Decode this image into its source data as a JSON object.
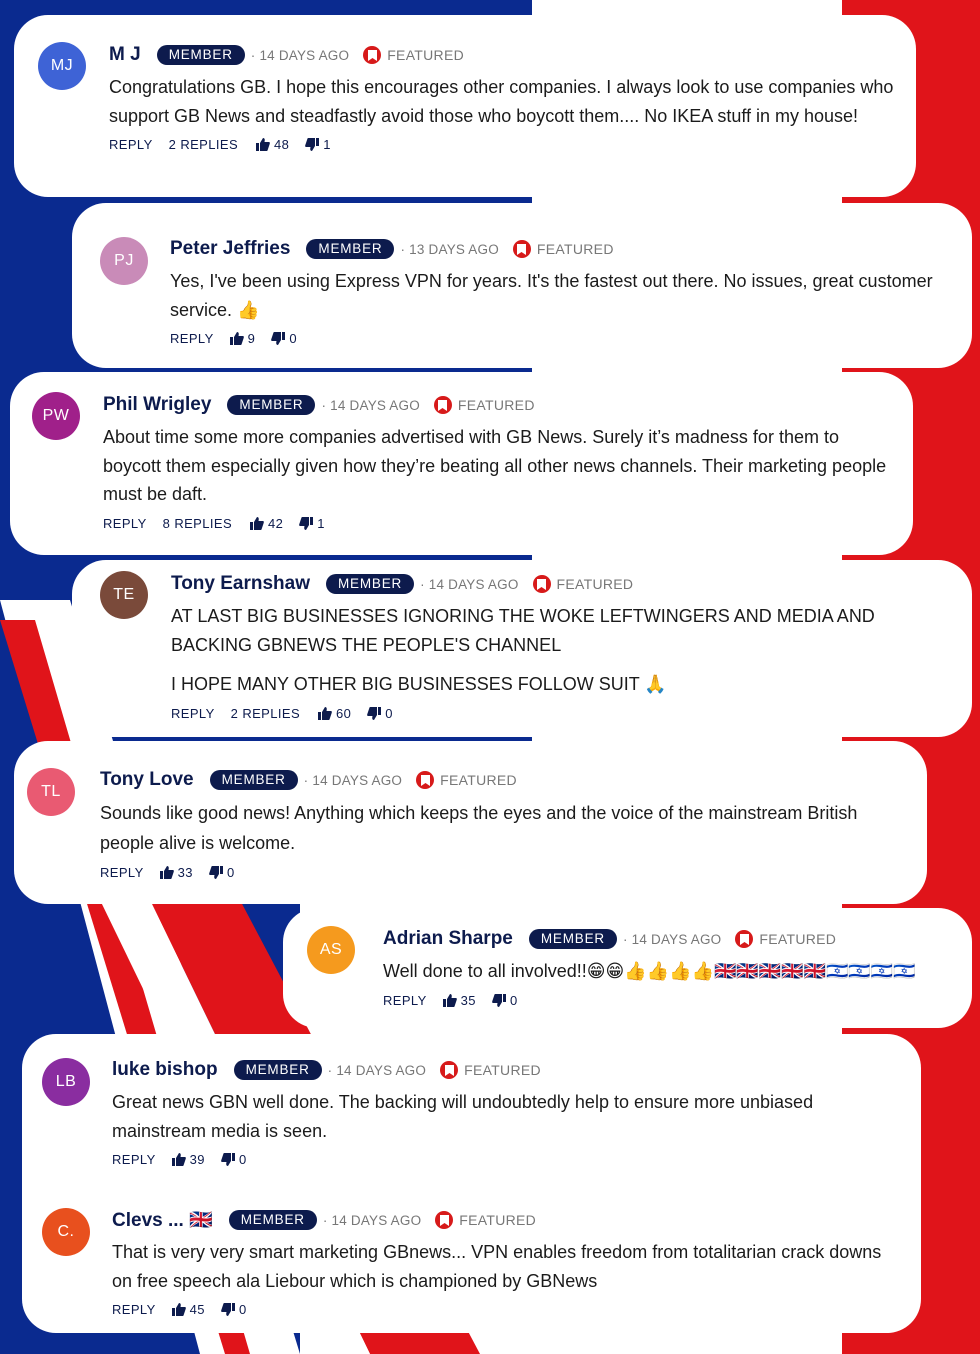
{
  "labels": {
    "member": "MEMBER",
    "featured": "FEATURED",
    "reply": "REPLY"
  },
  "colors": {
    "navy": "#0d1b4d",
    "red": "#d71a1a",
    "flag_blue": "#0a2a8f",
    "flag_red": "#e0141a"
  },
  "comments": [
    {
      "initials": "MJ",
      "name": "M J",
      "time": "14 DAYS AGO",
      "text": [
        "Congratulations GB. I hope this encourages other companies. I always look to use companies who support GB News and steadfastly avoid those who boycott them.... No IKEA stuff in my house!"
      ],
      "replies": "2 REPLIES",
      "likes": "48",
      "dislikes": "1",
      "avatar_color": "#3e63d6"
    },
    {
      "initials": "PJ",
      "name": "Peter Jeffries",
      "time": "13 DAYS AGO",
      "text": [
        "Yes, I've been using Express VPN for years. It's the fastest out there. No issues, great customer service. 👍"
      ],
      "replies": "",
      "likes": "9",
      "dislikes": "0",
      "avatar_color": "#c98bb8"
    },
    {
      "initials": "PW",
      "name": "Phil Wrigley",
      "time": "14 DAYS AGO",
      "text": [
        "About time some more companies advertised with GB News. Surely it’s madness for them to boycott them especially given how they’re beating all other news channels. Their marketing people must be daft."
      ],
      "replies": "8 REPLIES",
      "likes": "42",
      "dislikes": "1",
      "avatar_color": "#a0208a"
    },
    {
      "initials": "TE",
      "name": "Tony Earnshaw",
      "time": "14 DAYS AGO",
      "text": [
        "AT LAST BIG BUSINESSES IGNORING THE WOKE LEFTWINGERS AND MEDIA AND BACKING GBNEWS THE PEOPLE'S CHANNEL",
        "I HOPE MANY OTHER BIG BUSINESSES FOLLOW SUIT 🙏"
      ],
      "replies": "2 REPLIES",
      "likes": "60",
      "dislikes": "0",
      "avatar_color": "#7a4a3a"
    },
    {
      "initials": "TL",
      "name": "Tony Love",
      "time": "14 DAYS AGO",
      "text": [
        "Sounds like good news! Anything which keeps the eyes and the voice of the mainstream British people alive is welcome."
      ],
      "replies": "",
      "likes": "33",
      "dislikes": "0",
      "avatar_color": "#e95a72"
    },
    {
      "initials": "AS",
      "name": "Adrian Sharpe",
      "time": "14 DAYS AGO",
      "text": [
        "Well done to all involved!!😁😁👍👍👍👍🇬🇧🇬🇧🇬🇧🇬🇧🇬🇧🇮🇱🇮🇱🇮🇱🇮🇱"
      ],
      "replies": "",
      "likes": "35",
      "dislikes": "0",
      "avatar_color": "#f59a1e"
    },
    {
      "initials": "LB",
      "name": "luke bishop",
      "time": "14 DAYS AGO",
      "text": [
        "Great news GBN well done. The backing will undoubtedly help to ensure more unbiased mainstream media is seen."
      ],
      "replies": "",
      "likes": "39",
      "dislikes": "0",
      "avatar_color": "#8a2da0"
    },
    {
      "initials": "C.",
      "name": "Clevs ... 🇬🇧",
      "time": "14 DAYS AGO",
      "text": [
        "That is very very smart marketing GBnews... VPN enables freedom from totalitarian crack downs on free speech ala Liebour which is championed by GBNews"
      ],
      "replies": "",
      "likes": "45",
      "dislikes": "0",
      "avatar_color": "#e8501e"
    }
  ]
}
